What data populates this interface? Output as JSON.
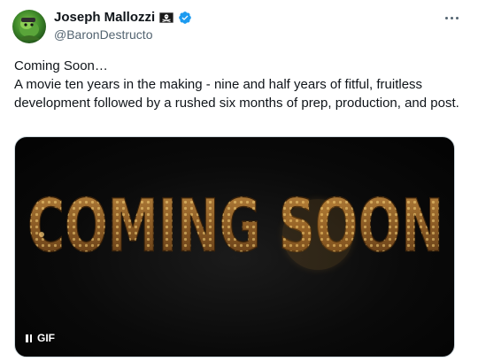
{
  "author": {
    "display_name": "Joseph Mallozzi",
    "handle": "@BaronDestructo",
    "badge_icon": "pirate-flag-icon",
    "verified_icon": "verified-badge-icon",
    "verified_color": "#1d9bf0"
  },
  "tweet": {
    "lines": [
      "Coming Soon…",
      "A movie ten years in the making - nine and half years of fitful, fruitless development followed by a rushed six months of prep, production, and post."
    ]
  },
  "media": {
    "marquee_text": "COMING SOON",
    "gif_label": "GIF",
    "pause_icon": "pause-icon"
  },
  "menu": {
    "icon": "more-horizontal-icon"
  }
}
